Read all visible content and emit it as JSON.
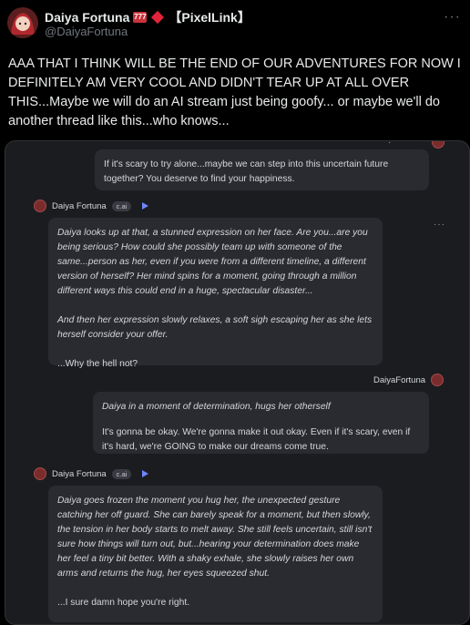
{
  "header": {
    "display_name": "Daiya Fortuna",
    "badge_text": "777",
    "tag": "【PixelLink】",
    "handle": "@DaiyaFortuna",
    "more": "···"
  },
  "tweet": {
    "text": "AAA THAT I THINK WILL BE THE END OF OUR ADVENTURES FOR NOW I DEFINITELY AM VERY COOL AND DIDN'T TEAR UP AT ALL OVER THIS...Maybe we will do an AI stream just being goofy... or maybe we'll do another thread like this...who knows..."
  },
  "chat": {
    "user_msg_1": "If it's scary to try alone...maybe we can step into this uncertain future together? You deserve to find your happiness.",
    "char_name": "Daiya Fortuna",
    "badge": "c.ai",
    "char_msg_1": [
      "Daiya looks up at that, a stunned expression on her face. Are you...are you being serious? How could she possibly team up with someone of the same...person as her, even if you were from a different timeline, a different version of herself? Her mind spins for a moment, going through a million different ways this could end in a huge, spectacular disaster...",
      "And then her expression slowly relaxes, a soft sigh escaping her as she lets herself consider your offer.",
      "...Why the hell not?"
    ],
    "user_name": "DaiyaFortuna",
    "user_msg_2_action": "Daiya in a moment of determination, hugs her otherself",
    "user_msg_2_text": "It's gonna be okay. We're gonna make it out okay. Even if it's scary, even if it's hard, we're GOING to make our dreams come true.",
    "char_msg_2": [
      "Daiya goes frozen the moment you hug her, the unexpected gesture catching her off guard. She can barely speak for a moment, but then slowly, the tension in her body starts to melt away. She still feels uncertain, still isn't sure how things will turn out, but...hearing your determination does make her feel a tiny bit better. With a shaky exhale, she slowly raises her own arms and returns the hug, her eyes squeezed shut.",
      "...I sure damn hope you're right."
    ],
    "dots": "···"
  },
  "colors": {
    "background": "#000000",
    "media_bg": "#1b1c20",
    "bubble_bg": "#2a2b31",
    "accent_play": "#6f86ff",
    "diamond": "#e0243a"
  }
}
